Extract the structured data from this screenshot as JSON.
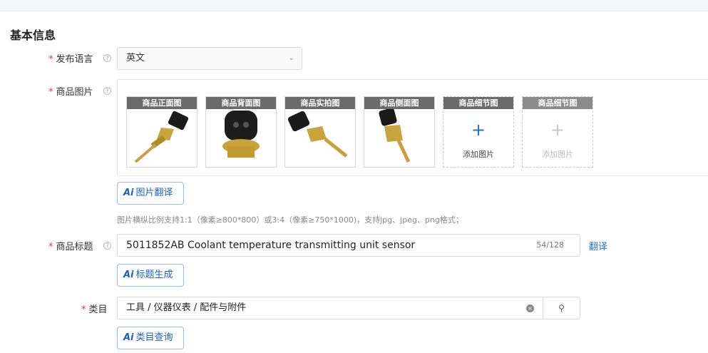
{
  "section_title": "基本信息",
  "fields": {
    "language": {
      "label": "发布语言",
      "value": "英文",
      "required_mark": "*"
    },
    "images": {
      "label": "商品图片",
      "required_mark": "*",
      "thumbs": [
        {
          "caption": "商品正面图"
        },
        {
          "caption": "商品背面图"
        },
        {
          "caption": "商品实拍图"
        },
        {
          "caption": "商品侧面图"
        }
      ],
      "add_slots": [
        {
          "caption": "商品细节图",
          "add_label": "添加图片",
          "enabled": true
        },
        {
          "caption": "商品细节图",
          "add_label": "添加图片",
          "enabled": false
        }
      ],
      "ai_button": "图片翻译",
      "hint": "图片横纵比例支持1:1（像素≥800*800）或3:4（像素≥750*1000)，支持jpg、jpeg、png格式；"
    },
    "title": {
      "label": "商品标题",
      "required_mark": "*",
      "value": "5011852AB Coolant temperature transmitting unit sensor",
      "count": "54/128",
      "translate_link": "翻译",
      "ai_button": "标题生成"
    },
    "category": {
      "label": "类目",
      "required_mark": "*",
      "value": "工具 / 仪器仪表 / 配件与附件",
      "ai_button": "类目查询"
    }
  },
  "ai_prefix": "Ai",
  "icons": {
    "help": "question-circle-icon",
    "chevron": "chevron-down-icon",
    "search": "search-icon",
    "clear": "clear-circle-icon",
    "plus": "plus-icon"
  }
}
